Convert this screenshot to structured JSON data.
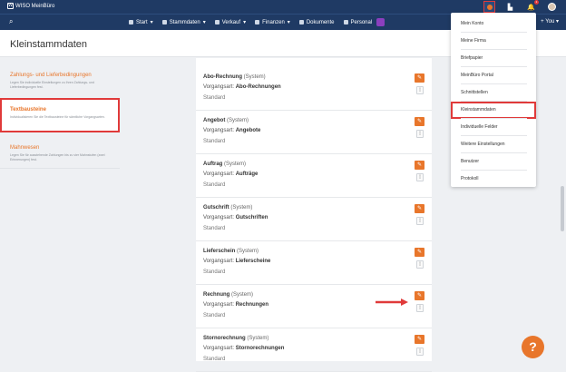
{
  "topbar": {
    "logo_text": "WISO MeinBüro",
    "logo_mark": "W",
    "notification_count": "1"
  },
  "navbar": {
    "items": [
      {
        "label": "Start",
        "icon": "start-icon"
      },
      {
        "label": "Stammdaten",
        "icon": "people-icon"
      },
      {
        "label": "Verkauf",
        "icon": "document-icon"
      },
      {
        "label": "Finanzen",
        "icon": "bank-icon"
      },
      {
        "label": "Dokumente",
        "icon": "folder-icon"
      },
      {
        "label": "Personal",
        "icon": "personal-icon"
      }
    ],
    "right_label": "+ You ▾"
  },
  "header": {
    "title": "Kleinstammdaten"
  },
  "sidebar": {
    "items": [
      {
        "title": "Zahlungs- und Lieferbedingungen",
        "desc": "Legen Sie individuelle Einstellungen zu Ihren Zahlungs- und Lieferbedingungen fest."
      },
      {
        "title": "Textbausteine",
        "desc": "Individualisieren Sie die Textbausteine für sämtliche Vorgangsarten."
      },
      {
        "title": "Mahnwesen",
        "desc": "Legen Sie für ausstehende Zahlungen bis zu vier Mahnstufen (zwei Erinnerungen) fest."
      }
    ]
  },
  "rows": [
    {
      "name": "Abo-Rechnung",
      "tag": "(System)",
      "type_label": "Vorgangsart:",
      "type": "Abo-Rechnungen",
      "std": "Standard"
    },
    {
      "name": "Angebot",
      "tag": "(System)",
      "type_label": "Vorgangsart:",
      "type": "Angebote",
      "std": "Standard"
    },
    {
      "name": "Auftrag",
      "tag": "(System)",
      "type_label": "Vorgangsart:",
      "type": "Aufträge",
      "std": "Standard"
    },
    {
      "name": "Gutschrift",
      "tag": "(System)",
      "type_label": "Vorgangsart:",
      "type": "Gutschriften",
      "std": "Standard"
    },
    {
      "name": "Lieferschein",
      "tag": "(System)",
      "type_label": "Vorgangsart:",
      "type": "Lieferscheine",
      "std": "Standard"
    },
    {
      "name": "Rechnung",
      "tag": "(System)",
      "type_label": "Vorgangsart:",
      "type": "Rechnungen",
      "std": "Standard"
    },
    {
      "name": "Stornorechnung",
      "tag": "(System)",
      "type_label": "Vorgangsart:",
      "type": "Stornorechnungen",
      "std": "Standard"
    }
  ],
  "dropdown": {
    "items": [
      "Mein Konto",
      "Meine Firma",
      "Briefpapier",
      "MeinBüro Portal",
      "Schnittstellen",
      "Kleinstammdaten",
      "Individuelle Felder",
      "Weitere Einstellungen",
      "Benutzer",
      "Protokoll"
    ],
    "active_index": 5
  },
  "help": {
    "label": "?"
  },
  "colors": {
    "nav": "#1f3a64",
    "accent": "#e8762b",
    "highlight": "#e03a3a"
  }
}
